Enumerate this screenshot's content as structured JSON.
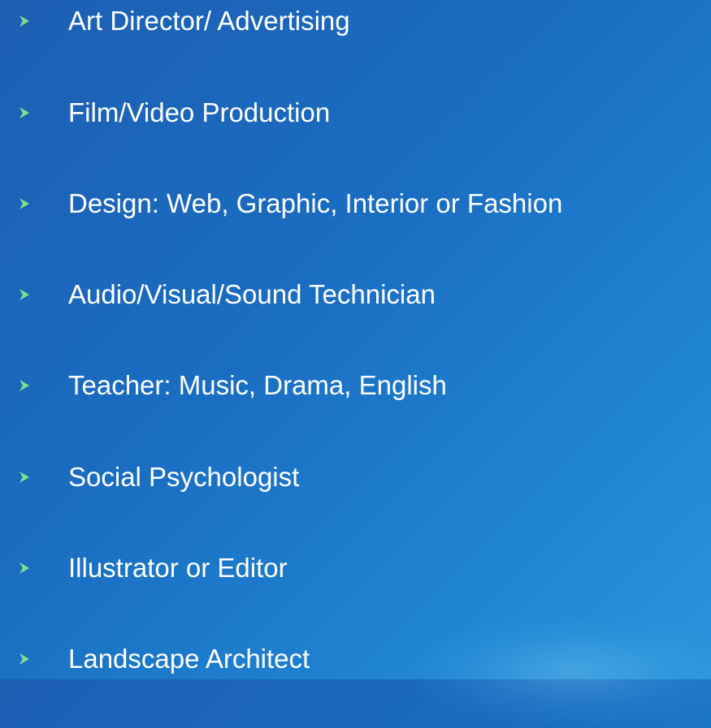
{
  "items": [
    {
      "label": "Art Director/ Advertising"
    },
    {
      "label": "Film/Video Production"
    },
    {
      "label": "Design: Web, Graphic, Interior or Fashion"
    },
    {
      "label": "Audio/Visual/Sound Technician"
    },
    {
      "label": "Teacher: Music, Drama, English"
    },
    {
      "label": "Social Psychologist"
    },
    {
      "label": "Illustrator or Editor"
    },
    {
      "label": "Landscape Architect"
    }
  ],
  "colors": {
    "background": "#1d6cc0",
    "text": "#ffffff",
    "bullet": "#7fe08a"
  },
  "bullet_icon": "arrow-bullet-icon"
}
